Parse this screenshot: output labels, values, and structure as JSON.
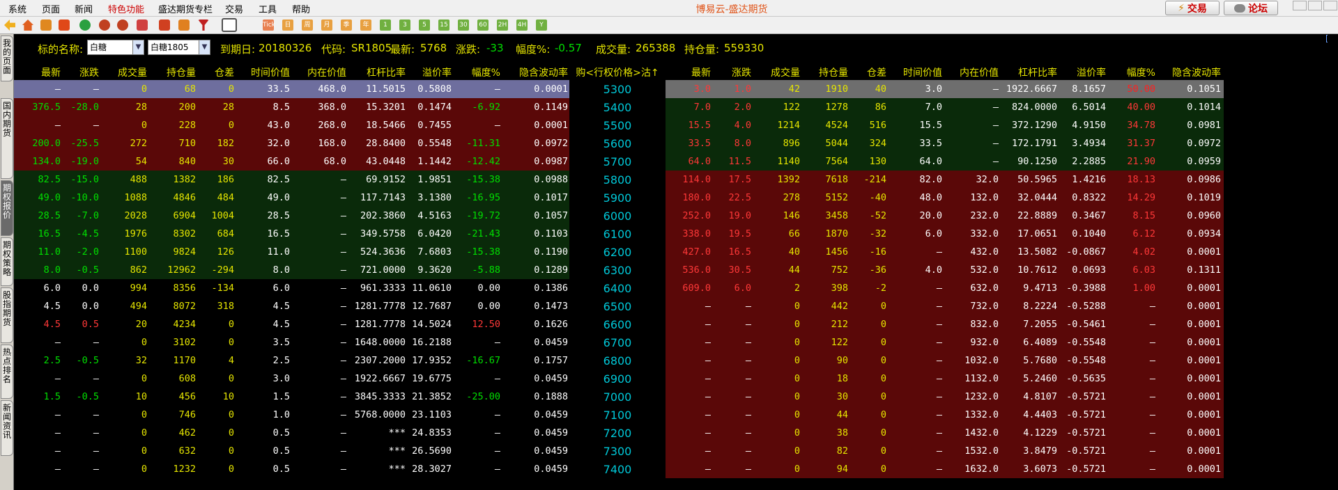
{
  "menu": [
    "系统",
    "页面",
    "新闻",
    "特色功能",
    "盛达期货专栏",
    "交易",
    "工具",
    "帮助"
  ],
  "active_menu_index": 3,
  "app_title": "博易云-盛达期货",
  "top_buttons": {
    "trade": "交易",
    "forum": "论坛"
  },
  "toolbar_periods": [
    "Tick",
    "日",
    "周",
    "月",
    "季",
    "年",
    "1",
    "3",
    "5",
    "15",
    "30",
    "60",
    "2H",
    "4H",
    "Y"
  ],
  "left_tabs": [
    "我的页面",
    "国内期货",
    "期权报价",
    "期权策略",
    "股指期货",
    "热点排名",
    "新闻资讯"
  ],
  "active_left_tab_index": 2,
  "filter": {
    "underlying_label": "标的名称:",
    "underlying_select": "白糖",
    "contract_select": "白糖1805",
    "expiry_label": "到期日:",
    "expiry_value": "20180326",
    "code_label": "代码:",
    "code_value": "SR1805",
    "last_label": "最新:",
    "last_value": "5768",
    "change_label": "涨跌:",
    "change_value": "-33",
    "pct_label": "幅度%:",
    "pct_value": "-0.57",
    "volume_label": "成交量:",
    "volume_value": "265388",
    "oi_label": "持仓量:",
    "oi_value": "559330"
  },
  "columns": {
    "left": [
      "最新",
      "涨跌",
      "成交量",
      "持仓量",
      "仓差",
      "时间价值",
      "内在价值",
      "杠杆比率",
      "溢价率",
      "幅度%",
      "隐含波动率"
    ],
    "center": "购<行权价格>沽↑",
    "right": [
      "最新",
      "涨跌",
      "成交量",
      "持仓量",
      "仓差",
      "时间价值",
      "内在价值",
      "杠杆比率",
      "溢价率",
      "幅度%",
      "隐含波动率"
    ]
  },
  "colors": {
    "up": "#ff3838",
    "down": "#00e000",
    "neutral": "#ffffff",
    "volume": "#e6e600",
    "strike": "#00c8d8",
    "header": "#e6e600"
  },
  "rows": [
    {
      "strike": "5300",
      "call": [
        "—",
        "—",
        "0",
        "68",
        "0",
        "33.5",
        "468.0",
        "11.5015",
        "0.5808",
        "—",
        "0.0001"
      ],
      "call_dir": "n",
      "put": [
        "3.0",
        "1.0",
        "42",
        "1910",
        "40",
        "3.0",
        "—",
        "1922.6667",
        "8.1657",
        "50.00",
        "0.1051"
      ],
      "put_dir": "u"
    },
    {
      "strike": "5400",
      "call": [
        "376.5",
        "-28.0",
        "28",
        "200",
        "28",
        "8.5",
        "368.0",
        "15.3201",
        "0.1474",
        "-6.92",
        "0.1149"
      ],
      "call_dir": "d",
      "put": [
        "7.0",
        "2.0",
        "122",
        "1278",
        "86",
        "7.0",
        "—",
        "824.0000",
        "6.5014",
        "40.00",
        "0.1014"
      ],
      "put_dir": "u"
    },
    {
      "strike": "5500",
      "call": [
        "—",
        "—",
        "0",
        "228",
        "0",
        "43.0",
        "268.0",
        "18.5466",
        "0.7455",
        "—",
        "0.0001"
      ],
      "call_dir": "n",
      "put": [
        "15.5",
        "4.0",
        "1214",
        "4524",
        "516",
        "15.5",
        "—",
        "372.1290",
        "4.9150",
        "34.78",
        "0.0981"
      ],
      "put_dir": "u"
    },
    {
      "strike": "5600",
      "call": [
        "200.0",
        "-25.5",
        "272",
        "710",
        "182",
        "32.0",
        "168.0",
        "28.8400",
        "0.5548",
        "-11.31",
        "0.0972"
      ],
      "call_dir": "d",
      "put": [
        "33.5",
        "8.0",
        "896",
        "5044",
        "324",
        "33.5",
        "—",
        "172.1791",
        "3.4934",
        "31.37",
        "0.0972"
      ],
      "put_dir": "u"
    },
    {
      "strike": "5700",
      "call": [
        "134.0",
        "-19.0",
        "54",
        "840",
        "30",
        "66.0",
        "68.0",
        "43.0448",
        "1.1442",
        "-12.42",
        "0.0987"
      ],
      "call_dir": "d",
      "put": [
        "64.0",
        "11.5",
        "1140",
        "7564",
        "130",
        "64.0",
        "—",
        "90.1250",
        "2.2885",
        "21.90",
        "0.0959"
      ],
      "put_dir": "u"
    },
    {
      "strike": "5800",
      "call": [
        "82.5",
        "-15.0",
        "488",
        "1382",
        "186",
        "82.5",
        "—",
        "69.9152",
        "1.9851",
        "-15.38",
        "0.0988"
      ],
      "call_dir": "d",
      "put": [
        "114.0",
        "17.5",
        "1392",
        "7618",
        "-214",
        "82.0",
        "32.0",
        "50.5965",
        "1.4216",
        "18.13",
        "0.0986"
      ],
      "put_dir": "u"
    },
    {
      "strike": "5900",
      "call": [
        "49.0",
        "-10.0",
        "1088",
        "4846",
        "484",
        "49.0",
        "—",
        "117.7143",
        "3.1380",
        "-16.95",
        "0.1017"
      ],
      "call_dir": "d",
      "put": [
        "180.0",
        "22.5",
        "278",
        "5152",
        "-40",
        "48.0",
        "132.0",
        "32.0444",
        "0.8322",
        "14.29",
        "0.1019"
      ],
      "put_dir": "u"
    },
    {
      "strike": "6000",
      "call": [
        "28.5",
        "-7.0",
        "2028",
        "6904",
        "1004",
        "28.5",
        "—",
        "202.3860",
        "4.5163",
        "-19.72",
        "0.1057"
      ],
      "call_dir": "d",
      "put": [
        "252.0",
        "19.0",
        "146",
        "3458",
        "-52",
        "20.0",
        "232.0",
        "22.8889",
        "0.3467",
        "8.15",
        "0.0960"
      ],
      "put_dir": "u"
    },
    {
      "strike": "6100",
      "call": [
        "16.5",
        "-4.5",
        "1976",
        "8302",
        "684",
        "16.5",
        "—",
        "349.5758",
        "6.0420",
        "-21.43",
        "0.1103"
      ],
      "call_dir": "d",
      "put": [
        "338.0",
        "19.5",
        "66",
        "1870",
        "-32",
        "6.0",
        "332.0",
        "17.0651",
        "0.1040",
        "6.12",
        "0.0934"
      ],
      "put_dir": "u"
    },
    {
      "strike": "6200",
      "call": [
        "11.0",
        "-2.0",
        "1100",
        "9824",
        "126",
        "11.0",
        "—",
        "524.3636",
        "7.6803",
        "-15.38",
        "0.1190"
      ],
      "call_dir": "d",
      "put": [
        "427.0",
        "16.5",
        "40",
        "1456",
        "-16",
        "—",
        "432.0",
        "13.5082",
        "-0.0867",
        "4.02",
        "0.0001"
      ],
      "put_dir": "u"
    },
    {
      "strike": "6300",
      "call": [
        "8.0",
        "-0.5",
        "862",
        "12962",
        "-294",
        "8.0",
        "—",
        "721.0000",
        "9.3620",
        "-5.88",
        "0.1289"
      ],
      "call_dir": "d",
      "put": [
        "536.0",
        "30.5",
        "44",
        "752",
        "-36",
        "4.0",
        "532.0",
        "10.7612",
        "0.0693",
        "6.03",
        "0.1311"
      ],
      "put_dir": "u"
    },
    {
      "strike": "6400",
      "call": [
        "6.0",
        "0.0",
        "994",
        "8356",
        "-134",
        "6.0",
        "—",
        "961.3333",
        "11.0610",
        "0.00",
        "0.1386"
      ],
      "call_dir": "n",
      "put": [
        "609.0",
        "6.0",
        "2",
        "398",
        "-2",
        "—",
        "632.0",
        "9.4713",
        "-0.3988",
        "1.00",
        "0.0001"
      ],
      "put_dir": "u"
    },
    {
      "strike": "6500",
      "call": [
        "4.5",
        "0.0",
        "494",
        "8072",
        "318",
        "4.5",
        "—",
        "1281.7778",
        "12.7687",
        "0.00",
        "0.1473"
      ],
      "call_dir": "n",
      "put": [
        "—",
        "—",
        "0",
        "442",
        "0",
        "—",
        "732.0",
        "8.2224",
        "-0.5288",
        "—",
        "0.0001"
      ],
      "put_dir": "n"
    },
    {
      "strike": "6600",
      "call": [
        "4.5",
        "0.5",
        "20",
        "4234",
        "0",
        "4.5",
        "—",
        "1281.7778",
        "14.5024",
        "12.50",
        "0.1626"
      ],
      "call_dir": "u",
      "put": [
        "—",
        "—",
        "0",
        "212",
        "0",
        "—",
        "832.0",
        "7.2055",
        "-0.5461",
        "—",
        "0.0001"
      ],
      "put_dir": "n"
    },
    {
      "strike": "6700",
      "call": [
        "—",
        "—",
        "0",
        "3102",
        "0",
        "3.5",
        "—",
        "1648.0000",
        "16.2188",
        "—",
        "0.0459"
      ],
      "call_dir": "n",
      "put": [
        "—",
        "—",
        "0",
        "122",
        "0",
        "—",
        "932.0",
        "6.4089",
        "-0.5548",
        "—",
        "0.0001"
      ],
      "put_dir": "n"
    },
    {
      "strike": "6800",
      "call": [
        "2.5",
        "-0.5",
        "32",
        "1170",
        "4",
        "2.5",
        "—",
        "2307.2000",
        "17.9352",
        "-16.67",
        "0.1757"
      ],
      "call_dir": "d",
      "put": [
        "—",
        "—",
        "0",
        "90",
        "0",
        "—",
        "1032.0",
        "5.7680",
        "-0.5548",
        "—",
        "0.0001"
      ],
      "put_dir": "n"
    },
    {
      "strike": "6900",
      "call": [
        "—",
        "—",
        "0",
        "608",
        "0",
        "3.0",
        "—",
        "1922.6667",
        "19.6775",
        "—",
        "0.0459"
      ],
      "call_dir": "n",
      "put": [
        "—",
        "—",
        "0",
        "18",
        "0",
        "—",
        "1132.0",
        "5.2460",
        "-0.5635",
        "—",
        "0.0001"
      ],
      "put_dir": "n"
    },
    {
      "strike": "7000",
      "call": [
        "1.5",
        "-0.5",
        "10",
        "456",
        "10",
        "1.5",
        "—",
        "3845.3333",
        "21.3852",
        "-25.00",
        "0.1888"
      ],
      "call_dir": "d",
      "put": [
        "—",
        "—",
        "0",
        "30",
        "0",
        "—",
        "1232.0",
        "4.8107",
        "-0.5721",
        "—",
        "0.0001"
      ],
      "put_dir": "n"
    },
    {
      "strike": "7100",
      "call": [
        "—",
        "—",
        "0",
        "746",
        "0",
        "1.0",
        "—",
        "5768.0000",
        "23.1103",
        "—",
        "0.0459"
      ],
      "call_dir": "n",
      "put": [
        "—",
        "—",
        "0",
        "44",
        "0",
        "—",
        "1332.0",
        "4.4403",
        "-0.5721",
        "—",
        "0.0001"
      ],
      "put_dir": "n"
    },
    {
      "strike": "7200",
      "call": [
        "—",
        "—",
        "0",
        "462",
        "0",
        "0.5",
        "—",
        "***",
        "24.8353",
        "—",
        "0.0459"
      ],
      "call_dir": "n",
      "put": [
        "—",
        "—",
        "0",
        "38",
        "0",
        "—",
        "1432.0",
        "4.1229",
        "-0.5721",
        "—",
        "0.0001"
      ],
      "put_dir": "n"
    },
    {
      "strike": "7300",
      "call": [
        "—",
        "—",
        "0",
        "632",
        "0",
        "0.5",
        "—",
        "***",
        "26.5690",
        "—",
        "0.0459"
      ],
      "call_dir": "n",
      "put": [
        "—",
        "—",
        "0",
        "82",
        "0",
        "—",
        "1532.0",
        "3.8479",
        "-0.5721",
        "—",
        "0.0001"
      ],
      "put_dir": "n"
    },
    {
      "strike": "7400",
      "call": [
        "—",
        "—",
        "0",
        "1232",
        "0",
        "0.5",
        "—",
        "***",
        "28.3027",
        "—",
        "0.0459"
      ],
      "call_dir": "n",
      "put": [
        "—",
        "—",
        "0",
        "94",
        "0",
        "—",
        "1632.0",
        "3.6073",
        "-0.5721",
        "—",
        "0.0001"
      ],
      "put_dir": "n"
    }
  ]
}
